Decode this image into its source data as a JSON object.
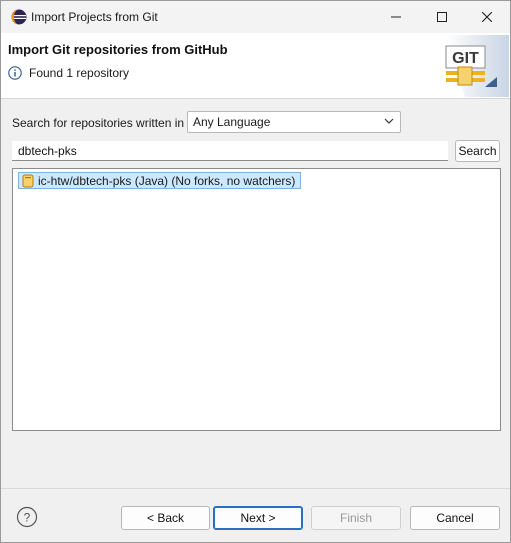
{
  "window": {
    "title": "Import Projects from Git",
    "controls": {
      "minimize": "—",
      "maximize": "☐",
      "close": "✕"
    }
  },
  "header": {
    "heading": "Import Git repositories from GitHub",
    "message": "Found 1 repository",
    "message_icon": "info-icon",
    "logo_text": "GIT"
  },
  "search": {
    "language_label": "Search for repositories written in",
    "language_selected": "Any Language",
    "query_value": "dbtech-pks",
    "search_button_label": "Search"
  },
  "results": [
    {
      "label": "ic-htw/dbtech-pks (Java) (No forks, no watchers)",
      "icon": "repository-icon",
      "selected": true
    }
  ],
  "buttons": {
    "back": "< Back",
    "next": "Next >",
    "finish": "Finish",
    "cancel": "Cancel"
  },
  "colors": {
    "selection_bg": "#cce8ff",
    "default_button_border": "#2a6fbf"
  }
}
